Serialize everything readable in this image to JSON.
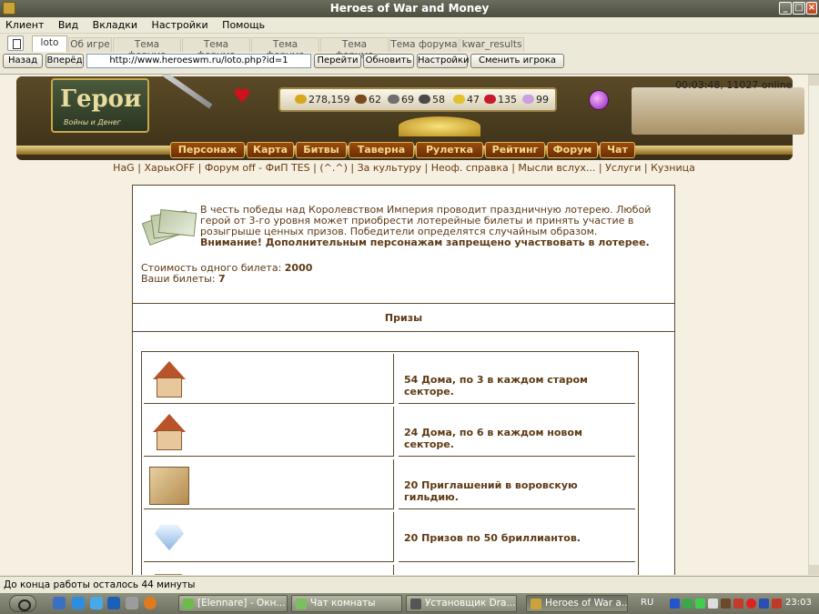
{
  "window": {
    "title": "Heroes of War and Money"
  },
  "menu": [
    "Клиент",
    "Вид",
    "Вкладки",
    "Настройки",
    "Помощь"
  ],
  "tabs": [
    "loto",
    "Об игре",
    "Тема форума",
    "Тема форума",
    "Тема форума",
    "Тема форума",
    "Тема форума",
    "kwar_results"
  ],
  "nav": {
    "back": "Назад",
    "forward": "Вперёд",
    "url": "http://www.heroeswm.ru/loto.php?id=1",
    "go": "Перейти",
    "refresh": "Обновить",
    "settings": "Настройки",
    "switch_player": "Сменить игрока"
  },
  "game": {
    "logo_title": "Герои",
    "logo_sub": "Войны и Денег",
    "clock": "00:03:48, 11027 online",
    "resources": [
      {
        "icon": "gold-icon",
        "value": "278,159",
        "color": "#d8a81c"
      },
      {
        "icon": "wood-icon",
        "value": "62",
        "color": "#7a4a20"
      },
      {
        "icon": "ore-icon",
        "value": "69",
        "color": "#6f6f6f"
      },
      {
        "icon": "mercury-icon",
        "value": "58",
        "color": "#4a4a4a"
      },
      {
        "icon": "sulfur-icon",
        "value": "47",
        "color": "#e2c130"
      },
      {
        "icon": "crystal-icon",
        "value": "135",
        "color": "#c81a2c"
      },
      {
        "icon": "gems-icon",
        "value": "99",
        "color": "#c9a0e0"
      }
    ],
    "main_nav": [
      "Персонаж",
      "Карта",
      "Битвы",
      "Таверна",
      "Рулетка",
      "Рейтинг",
      "Форум",
      "Чат"
    ],
    "sub_links": [
      "HaG",
      "ХарькOFF",
      "Форум off - ФиП TES",
      "(^.^)",
      "За культуру",
      "Неоф. справка",
      "Мысли вслух...",
      "Услуги",
      "Кузница"
    ]
  },
  "lottery": {
    "intro": "В честь победы над Королевством Империя проводит праздничную лотерею. Любой герой от 3-го уровня может приобрести лотерейные билеты и принять участие в розыгрыше ценных призов. Победители определятся случайным образом.",
    "warning": "Внимание! Дополнительным персонажам запрещено участвовать в лотерее.",
    "price_label": "Стоимость одного билета:",
    "price_value": "2000",
    "mytickets_label": "Ваши билеты:",
    "mytickets_value": "7",
    "prizes_header": "Призы",
    "prizes": [
      {
        "icon": "house-icon",
        "text": "54 Дома, по 3 в каждом старом секторе."
      },
      {
        "icon": "house-icon",
        "text": "24 Дома, по 6 в каждом новом секторе."
      },
      {
        "icon": "scroll-icon",
        "text": "20 Приглашений в воровскую гильдию."
      },
      {
        "icon": "diamond-icon",
        "text": "20 Призов по 50 бриллиантов."
      }
    ]
  },
  "status": "До конца работы осталось 44 минуты",
  "taskbar": {
    "tasks": [
      "[Elennare] - Окн...",
      "Чат комнаты",
      "Установщик Dra...",
      "Heroes of War a..."
    ],
    "lang": "RU",
    "time": "23:03"
  }
}
